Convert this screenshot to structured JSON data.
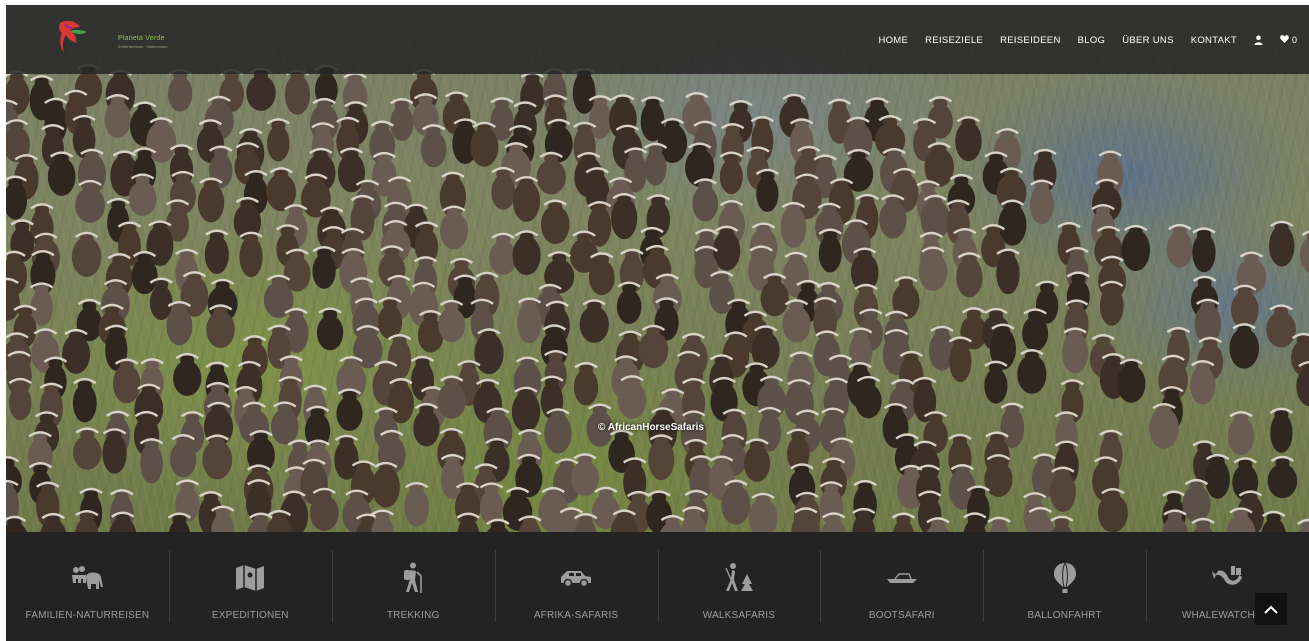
{
  "brand": {
    "name": "Planeta Verde",
    "tagline": "Erlebnisreisen · Naturreisen"
  },
  "nav": {
    "items": [
      "HOME",
      "REISEZIELE",
      "REISEIDEEN",
      "BLOG",
      "ÜBER UNS",
      "KONTAKT"
    ],
    "user_icon": "user-icon",
    "cart_icon": "heart-icon",
    "cart_count": "0"
  },
  "hero": {
    "credit": "© AfricanHorseSafaris"
  },
  "categories": [
    {
      "label": "FAMILIEN-NATURREISEN",
      "icon": "family-elephant-icon"
    },
    {
      "label": "EXPEDITIONEN",
      "icon": "map-icon"
    },
    {
      "label": "TREKKING",
      "icon": "hiker-icon"
    },
    {
      "label": "AFRIKA-SAFARIS",
      "icon": "jeep-icon"
    },
    {
      "label": "WALKSAFARIS",
      "icon": "walking-safari-icon"
    },
    {
      "label": "BOOTSAFARI",
      "icon": "boat-icon"
    },
    {
      "label": "BALLONFAHRT",
      "icon": "balloon-icon"
    },
    {
      "label": "WHALEWATCHING",
      "icon": "whale-icon"
    }
  ],
  "scroll_top_icon": "chevron-up-icon",
  "colors": {
    "nav_bg": "#262626",
    "bar_bg": "#232323",
    "label": "#9d9d9d",
    "brand_green": "#8bc34a"
  }
}
